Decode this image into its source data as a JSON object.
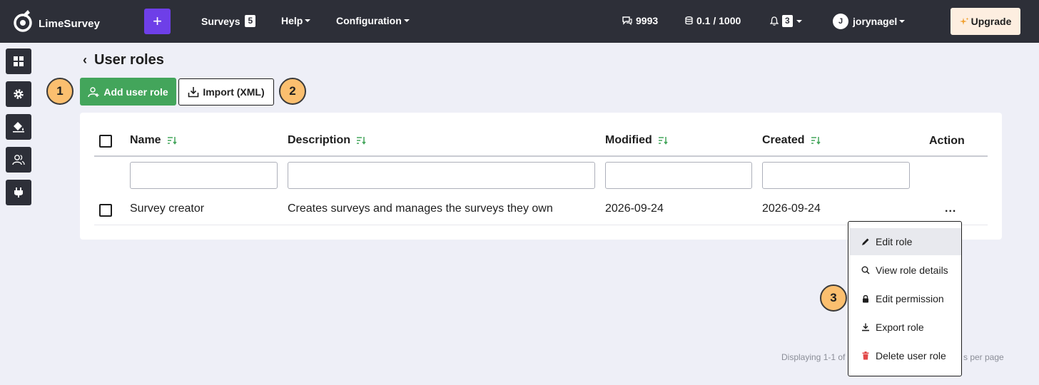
{
  "brand": {
    "name": "LimeSurvey"
  },
  "topbar": {
    "surveys_label": "Surveys",
    "surveys_count": "5",
    "help_label": "Help",
    "configuration_label": "Configuration",
    "responses_count": "9993",
    "storage": "0.1 / 1000",
    "notifications_count": "3",
    "user_initial": "J",
    "username": "jorynagel",
    "upgrade_label": "Upgrade"
  },
  "page": {
    "title": "User roles",
    "add_button": "Add user role",
    "import_button": "Import (XML)"
  },
  "callouts": {
    "one": "1",
    "two": "2",
    "three": "3"
  },
  "table": {
    "columns": {
      "name": "Name",
      "description": "Description",
      "modified": "Modified",
      "created": "Created",
      "action": "Action"
    },
    "rows": [
      {
        "name": "Survey creator",
        "description": "Creates surveys and manages the surveys they own",
        "modified": "2026-09-24",
        "created": "2026-09-24",
        "action": "..."
      }
    ]
  },
  "footer": {
    "displaying": "Displaying 1-1 of",
    "per_page": "s per page"
  },
  "action_menu": {
    "items": [
      {
        "label": "Edit role",
        "icon": "pencil-icon"
      },
      {
        "label": "View role details",
        "icon": "magnifier-icon"
      },
      {
        "label": "Edit permission",
        "icon": "lock-icon"
      },
      {
        "label": "Export role",
        "icon": "download-icon"
      },
      {
        "label": "Delete user role",
        "icon": "trash-icon"
      }
    ]
  },
  "colors": {
    "accent": "#6e3fe8",
    "success": "#43a55b",
    "callout": "#fbbf6f",
    "danger": "#e24a4a",
    "navbar": "#2d2f38"
  }
}
